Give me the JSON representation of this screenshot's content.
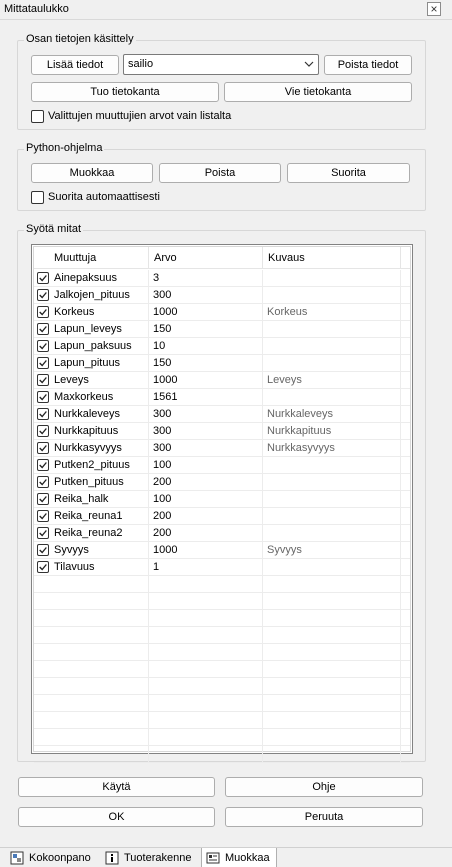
{
  "window": {
    "title": "Mittataulukko"
  },
  "data_group": {
    "label": "Osan tietojen käsittely",
    "add_button": "Lisää tiedot",
    "combo_value": "sailio",
    "delete_button": "Poista tiedot",
    "import_button": "Tuo tietokanta",
    "export_button": "Vie tietokanta",
    "checkbox_label": "Valittujen muuttujien arvot vain listalta",
    "checkbox_checked": false
  },
  "python_group": {
    "label": "Python-ohjelma",
    "edit_button": "Muokkaa",
    "delete_button": "Poista",
    "run_button": "Suorita",
    "auto_label": "Suorita automaattisesti",
    "auto_checked": false
  },
  "measures_group": {
    "label": "Syötä mitat",
    "columns": [
      "Muuttuja",
      "Arvo",
      "Kuvaus"
    ],
    "rows": [
      {
        "name": "Ainepaksuus",
        "value": "3",
        "desc": "",
        "checked": true
      },
      {
        "name": "Jalkojen_pituus",
        "value": "300",
        "desc": "",
        "checked": true
      },
      {
        "name": "Korkeus",
        "value": "1000",
        "desc": "Korkeus",
        "checked": true
      },
      {
        "name": "Lapun_leveys",
        "value": "150",
        "desc": "",
        "checked": true
      },
      {
        "name": "Lapun_paksuus",
        "value": "10",
        "desc": "",
        "checked": true
      },
      {
        "name": "Lapun_pituus",
        "value": "150",
        "desc": "",
        "checked": true
      },
      {
        "name": "Leveys",
        "value": "1000",
        "desc": "Leveys",
        "checked": true
      },
      {
        "name": "Maxkorkeus",
        "value": "1561",
        "desc": "",
        "checked": true
      },
      {
        "name": "Nurkkaleveys",
        "value": "300",
        "desc": "Nurkkaleveys",
        "checked": true
      },
      {
        "name": "Nurkkapituus",
        "value": "300",
        "desc": "Nurkkapituus",
        "checked": true
      },
      {
        "name": "Nurkkasyvyys",
        "value": "300",
        "desc": "Nurkkasyvyys",
        "checked": true
      },
      {
        "name": "Putken2_pituus",
        "value": "100",
        "desc": "",
        "checked": true
      },
      {
        "name": "Putken_pituus",
        "value": "200",
        "desc": "",
        "checked": true
      },
      {
        "name": "Reika_halk",
        "value": "100",
        "desc": "",
        "checked": true
      },
      {
        "name": "Reika_reuna1",
        "value": "200",
        "desc": "",
        "checked": true
      },
      {
        "name": "Reika_reuna2",
        "value": "200",
        "desc": "",
        "checked": true
      },
      {
        "name": "Syvyys",
        "value": "1000",
        "desc": "Syvyys",
        "checked": true
      },
      {
        "name": "Tilavuus",
        "value": "1",
        "desc": "",
        "checked": true
      }
    ],
    "empty_rows": 11
  },
  "footer": {
    "apply_button": "Käytä",
    "help_button": "Ohje",
    "ok_button": "OK",
    "cancel_button": "Peruuta"
  },
  "tabs": [
    {
      "label": "Kokoonpano",
      "icon": "assembly-icon",
      "active": false
    },
    {
      "label": "Tuoterakenne",
      "icon": "info-icon",
      "active": false
    },
    {
      "label": "Muokkaa",
      "icon": "form-icon",
      "active": true
    }
  ]
}
